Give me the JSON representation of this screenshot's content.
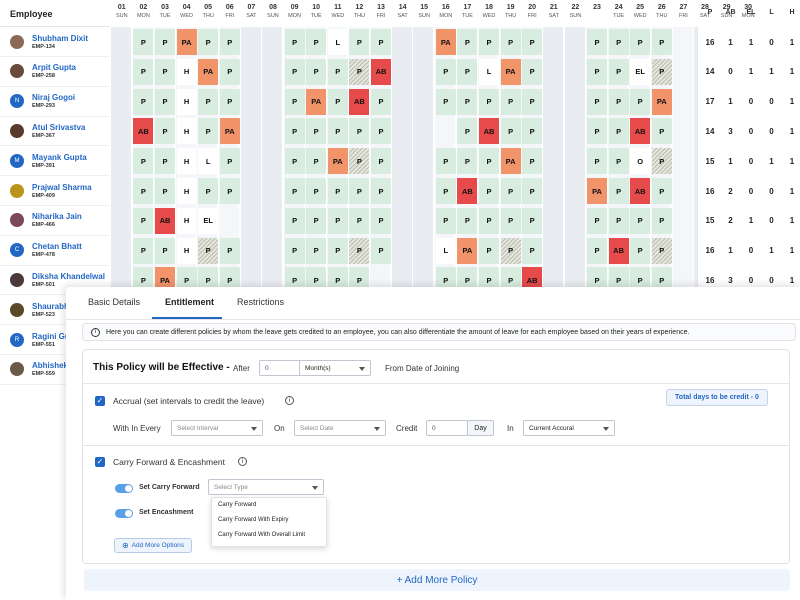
{
  "grid": {
    "employee_header": "Employee",
    "days": [
      {
        "d": "01",
        "w": "SUN"
      },
      {
        "d": "02",
        "w": "MON"
      },
      {
        "d": "03",
        "w": "TUE"
      },
      {
        "d": "04",
        "w": "WED"
      },
      {
        "d": "05",
        "w": "THU"
      },
      {
        "d": "06",
        "w": "FRI"
      },
      {
        "d": "07",
        "w": "SAT"
      },
      {
        "d": "08",
        "w": "SUN"
      },
      {
        "d": "09",
        "w": "MON"
      },
      {
        "d": "10",
        "w": "TUE"
      },
      {
        "d": "11",
        "w": "WED"
      },
      {
        "d": "12",
        "w": "THU"
      },
      {
        "d": "13",
        "w": "FRI"
      },
      {
        "d": "14",
        "w": "SAT"
      },
      {
        "d": "15",
        "w": "SUN"
      },
      {
        "d": "16",
        "w": "MON"
      },
      {
        "d": "17",
        "w": "TUE"
      },
      {
        "d": "18",
        "w": "WED"
      },
      {
        "d": "19",
        "w": "THU"
      },
      {
        "d": "20",
        "w": "FRI"
      },
      {
        "d": "21",
        "w": "SAT"
      },
      {
        "d": "22",
        "w": "SUN"
      },
      {
        "d": "23",
        "w": ""
      },
      {
        "d": "24",
        "w": "TUE"
      },
      {
        "d": "25",
        "w": "WED"
      },
      {
        "d": "26",
        "w": "THU"
      },
      {
        "d": "27",
        "w": "FRI"
      },
      {
        "d": "28",
        "w": "SAT"
      },
      {
        "d": "29",
        "w": "SUN"
      },
      {
        "d": "30",
        "w": "MON"
      }
    ],
    "summary_headers": [
      "P",
      "AB",
      "EL",
      "L",
      "H"
    ],
    "employees": [
      {
        "name": "Shubham Dixit",
        "id": "EMP-134",
        "avatar": "#8a6a55",
        "summary": [
          "16",
          "1",
          "1",
          "0",
          "1"
        ],
        "cells": [
          "",
          "P",
          "P",
          "PA",
          "P",
          "P",
          "",
          "",
          "P",
          "P",
          "L",
          "P",
          "P",
          "",
          "",
          "PA",
          "P",
          "P",
          "P",
          "P",
          "",
          "",
          "P",
          "P",
          "P",
          "P",
          "",
          "",
          "",
          ""
        ]
      },
      {
        "name": "Arpit Gupta",
        "id": "EMP-258",
        "avatar": "#6a4a3a",
        "summary": [
          "14",
          "0",
          "1",
          "1",
          "1"
        ],
        "cells": [
          "",
          "P",
          "P",
          "H",
          "PA",
          "P",
          "",
          "",
          "P",
          "P",
          "P",
          "P",
          "AB",
          "",
          "",
          "P",
          "P",
          "L",
          "PA",
          "P",
          "",
          "",
          "P",
          "P",
          "EL",
          "P",
          "",
          "",
          "",
          ""
        ]
      },
      {
        "name": "Niraj Gogoi",
        "id": "EMP-293",
        "avatar": "#2367c5",
        "initial": "N",
        "summary": [
          "17",
          "1",
          "0",
          "0",
          "1"
        ],
        "cells": [
          "",
          "P",
          "P",
          "H",
          "P",
          "P",
          "",
          "",
          "P",
          "PA",
          "P",
          "AB",
          "P",
          "",
          "",
          "P",
          "P",
          "P",
          "P",
          "P",
          "",
          "",
          "P",
          "P",
          "P",
          "PA",
          "",
          "",
          "",
          ""
        ]
      },
      {
        "name": "Atul Srivastva",
        "id": "EMP-367",
        "avatar": "#5a3a2a",
        "summary": [
          "14",
          "3",
          "0",
          "0",
          "1"
        ],
        "cells": [
          "",
          "AB",
          "P",
          "H",
          "P",
          "PA",
          "",
          "",
          "P",
          "P",
          "P",
          "P",
          "P",
          "",
          "",
          "",
          "P",
          "AB",
          "P",
          "P",
          "",
          "",
          "P",
          "P",
          "AB",
          "P",
          "",
          "",
          "",
          ""
        ]
      },
      {
        "name": "Mayank Gupta",
        "id": "EMP-391",
        "avatar": "#2367c5",
        "initial": "M",
        "summary": [
          "15",
          "1",
          "0",
          "1",
          "1"
        ],
        "cells": [
          "",
          "P",
          "P",
          "H",
          "L",
          "P",
          "",
          "",
          "P",
          "P",
          "PA",
          "P",
          "P",
          "",
          "",
          "P",
          "P",
          "P",
          "PA",
          "P",
          "",
          "",
          "P",
          "P",
          "O",
          "P",
          "",
          "",
          "",
          ""
        ]
      },
      {
        "name": "Prajwal Sharma",
        "id": "EMP-409",
        "avatar": "#b8941a",
        "summary": [
          "16",
          "2",
          "0",
          "0",
          "1"
        ],
        "cells": [
          "",
          "P",
          "P",
          "H",
          "P",
          "P",
          "",
          "",
          "P",
          "P",
          "P",
          "P",
          "P",
          "",
          "",
          "P",
          "AB",
          "P",
          "P",
          "P",
          "",
          "",
          "PA",
          "P",
          "AB",
          "P",
          "",
          "",
          "",
          ""
        ]
      },
      {
        "name": "Niharika Jain",
        "id": "EMP-466",
        "avatar": "#7a4a5a",
        "summary": [
          "15",
          "2",
          "1",
          "0",
          "1"
        ],
        "cells": [
          "",
          "P",
          "AB",
          "H",
          "EL",
          "",
          "",
          "",
          "P",
          "P",
          "P",
          "P",
          "P",
          "",
          "",
          "P",
          "P",
          "P",
          "P",
          "P",
          "",
          "",
          "P",
          "P",
          "P",
          "P",
          "",
          "",
          "",
          ""
        ]
      },
      {
        "name": "Chetan Bhatt",
        "id": "EMP-478",
        "avatar": "#2367c5",
        "initial": "C",
        "summary": [
          "16",
          "1",
          "0",
          "1",
          "1"
        ],
        "cells": [
          "",
          "P",
          "P",
          "H",
          "P",
          "P",
          "",
          "",
          "P",
          "P",
          "P",
          "P",
          "P",
          "",
          "",
          "L",
          "PA",
          "P",
          "P",
          "P",
          "",
          "",
          "P",
          "AB",
          "P",
          "P",
          "",
          "",
          "",
          ""
        ]
      },
      {
        "name": "Diksha Khandelwal",
        "id": "EMP-501",
        "avatar": "#4a3a3a",
        "summary": [
          "16",
          "3",
          "0",
          "0",
          "1"
        ],
        "cells": [
          "",
          "P",
          "PA",
          "P",
          "P",
          "P",
          "",
          "",
          "P",
          "P",
          "P",
          "P",
          "",
          "",
          "",
          "P",
          "P",
          "P",
          "P",
          "AB",
          "",
          "",
          "P",
          "P",
          "P",
          "P",
          "",
          "",
          "",
          ""
        ]
      },
      {
        "name": "Shaurabh",
        "id": "EMP-523",
        "avatar": "#5a4a2a",
        "summary": [
          "",
          "",
          "",
          "",
          ""
        ],
        "cells": []
      },
      {
        "name": "Ragini Gu",
        "id": "EMP-551",
        "avatar": "#2367c5",
        "initial": "R",
        "summary": [
          "",
          "",
          "",
          "",
          ""
        ],
        "cells": []
      },
      {
        "name": "Abhishek",
        "id": "EMP-559",
        "avatar": "#6a5a4a",
        "summary": [
          "",
          "",
          "",
          "",
          ""
        ],
        "cells": []
      }
    ]
  },
  "panel": {
    "tabs": [
      "Basic Details",
      "Entitlement",
      "Restrictions"
    ],
    "active_tab": "Entitlement",
    "info": "Here you can create different policies by whom the leave gets credited to an employee, you can also differentiate the  amount of leave for each employee based on their years of experience.",
    "effective_label": "This Policy will be Effective -",
    "after_label": "After",
    "after_value": "0",
    "after_unit": "Month(s)",
    "from_label": "From Date of Joining",
    "accrual_label": "Accrual (set intervals to credit the leave)",
    "total_btn": "Total days to be credit - 0",
    "within_label": "With In Every",
    "interval_placeholder": "Select Interval",
    "on_label": "On",
    "date_placeholder": "Select Date",
    "credit_label": "Credit",
    "credit_value": "0",
    "credit_unit": "Day",
    "in_label": "In",
    "in_value": "Current Accural",
    "carry_label": "Carry Forward & Encashment",
    "set_carry_label": "Set Carry Forward",
    "type_placeholder": "Select Type",
    "set_encash_label": "Set Encashment",
    "dropdown_options": [
      "Carry Forward",
      "Carry Forward With Expiry",
      "Carry Forward With Overall Limit"
    ],
    "add_options": "Add More Options",
    "add_policy": "+ Add More Policy"
  }
}
